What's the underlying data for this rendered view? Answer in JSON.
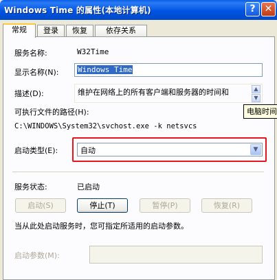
{
  "window": {
    "title": "Windows Time 的属性(本地计算机)",
    "help_label": "?",
    "close_label": "✕"
  },
  "tabs": [
    {
      "label": "常规"
    },
    {
      "label": "登录"
    },
    {
      "label": "恢复"
    },
    {
      "label": "依存关系"
    }
  ],
  "general": {
    "service_name_label": "服务名称:",
    "service_name_value": "W32Time",
    "display_name_label": "显示名称(N):",
    "display_name_value": "Windows Time",
    "description_label": "描述(D):",
    "description_value": "维护在网络上的所有客户端和服务器的时间和",
    "exe_path_label": "可执行文件的路径(H):",
    "exe_path_value": "C:\\WINDOWS\\System32\\svchost.exe -k netsvcs",
    "startup_type_label": "启动类型(E):",
    "startup_type_value": "自动",
    "service_status_label": "服务状态:",
    "service_status_value": "已启动",
    "hint_text": "当从此处启动服务时，您可指定所适用的启动参数。",
    "start_params_label": "启动参数(M):",
    "tooltip_text": "电脑时间"
  },
  "buttons": {
    "start": "启动(S)",
    "stop": "停止(T)",
    "pause": "暂停(P)",
    "resume": "恢复(R)"
  }
}
